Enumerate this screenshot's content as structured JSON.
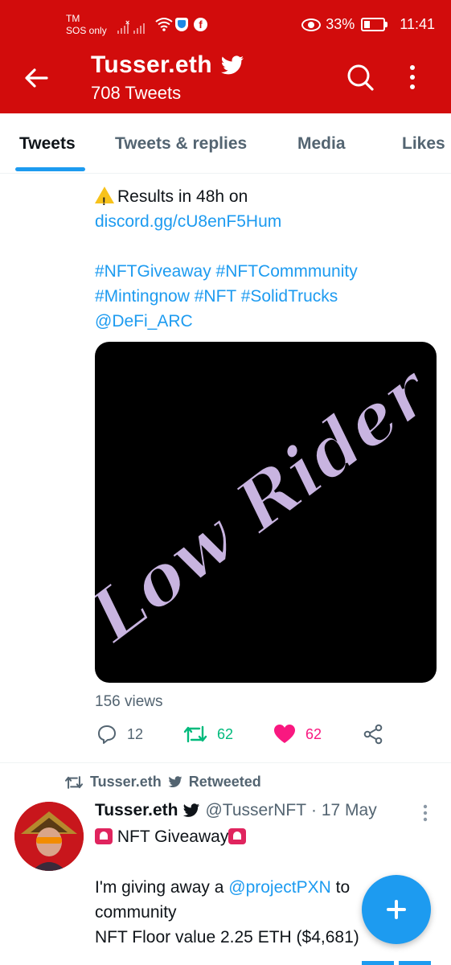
{
  "status_bar": {
    "carrier": "TM",
    "sos": "SOS only",
    "battery": "33%",
    "time": "11:41"
  },
  "header": {
    "title": "Tusser.eth",
    "subtitle": "708 Tweets",
    "back_icon": "arrow-left-icon",
    "search_icon": "search-icon",
    "more_icon": "kebab-icon",
    "verified_icon": "twitter-bird-icon"
  },
  "tabs": [
    {
      "label": "Tweets",
      "active": true
    },
    {
      "label": "Tweets & replies",
      "active": false
    },
    {
      "label": "Media",
      "active": false
    },
    {
      "label": "Likes",
      "active": false
    }
  ],
  "tweet1": {
    "line1": "Results in 48h on",
    "link": "discord.gg/cU8enF5Hum",
    "hashtags1": "#NFTGiveaway #NFTCommmunity",
    "hashtags2": "#Mintingnow #NFT #SolidTrucks",
    "mention": "@DeFi_ARC",
    "image_text": "Low Rider",
    "views": "156 views",
    "replies": "12",
    "retweets": "62",
    "likes": "62"
  },
  "retweet_label": {
    "user": "Tusser.eth",
    "action": "Retweeted"
  },
  "tweet2": {
    "name": "Tusser.eth",
    "handle": "@TusserNFT",
    "date": "· 17 May",
    "line1": "NFT Giveaway",
    "line2_pre": "I'm giving away a ",
    "line2_mention": "@projectPXN",
    "line2_post": " to",
    "line3": "community",
    "line4": "NFT Floor value 2.25 ETH ($4,681)"
  },
  "colors": {
    "header_bg": "#d20c0c",
    "accent": "#1d9bf0",
    "retweet": "#00ba7c",
    "like": "#f91880"
  }
}
